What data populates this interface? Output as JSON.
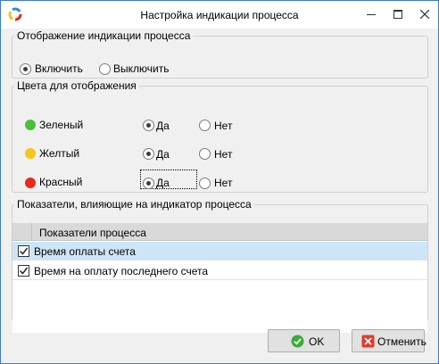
{
  "window": {
    "title": "Настройка индикации процесса",
    "accent_color": "#3a7bd5"
  },
  "display_group": {
    "legend": "Отображение индикации процесса",
    "options": [
      {
        "label": "Включить",
        "selected": true
      },
      {
        "label": "Выключить",
        "selected": false
      }
    ]
  },
  "colors_group": {
    "legend": "Цвета для отображения",
    "rows": [
      {
        "color_name": "Зеленый",
        "color": "#4bbf3a",
        "yes_label": "Да",
        "no_label": "Нет",
        "yes_selected": true
      },
      {
        "color_name": "Желтый",
        "color": "#f5c518",
        "yes_label": "Да",
        "no_label": "Нет",
        "yes_selected": true
      },
      {
        "color_name": "Красный",
        "color": "#e8291c",
        "yes_label": "Да",
        "no_label": "Нет",
        "yes_selected": true
      }
    ]
  },
  "indicators_group": {
    "legend": "Показатели, влияющие на индикатор процесса",
    "column_header": "Показатели процесса",
    "rows": [
      {
        "label": "Время оплаты счета",
        "checked": true,
        "selected": true
      },
      {
        "label": "Время на оплату последнего счета",
        "checked": true,
        "selected": false
      }
    ]
  },
  "buttons": {
    "ok_label": "OK",
    "cancel_label": "Отменить"
  }
}
